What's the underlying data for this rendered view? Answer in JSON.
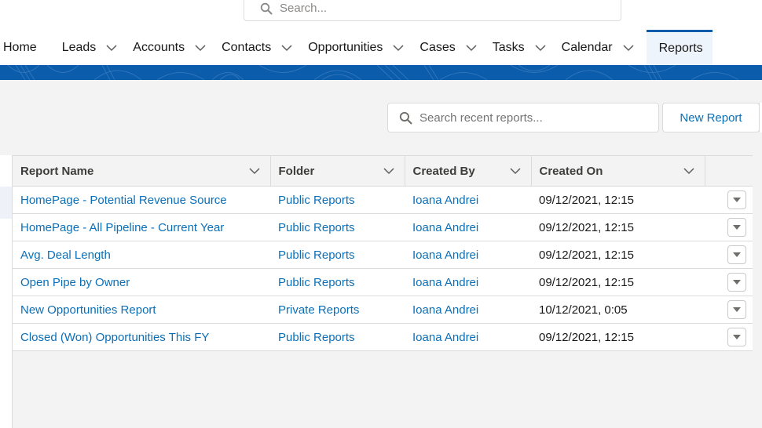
{
  "header": {
    "global_search_placeholder": "Search..."
  },
  "nav": {
    "items": [
      {
        "label": "Home",
        "has_menu": false
      },
      {
        "label": "Leads",
        "has_menu": true
      },
      {
        "label": "Accounts",
        "has_menu": true
      },
      {
        "label": "Contacts",
        "has_menu": true
      },
      {
        "label": "Opportunities",
        "has_menu": true
      },
      {
        "label": "Cases",
        "has_menu": true
      },
      {
        "label": "Tasks",
        "has_menu": true
      },
      {
        "label": "Calendar",
        "has_menu": true
      },
      {
        "label": "Reports",
        "has_menu": false,
        "active": true
      }
    ]
  },
  "toolbar": {
    "search_placeholder": "Search recent reports...",
    "new_report_label": "New Report"
  },
  "table": {
    "columns": [
      "Report Name",
      "Folder",
      "Created By",
      "Created On"
    ],
    "rows": [
      {
        "name": "HomePage - Potential Revenue Source",
        "folder": "Public Reports",
        "created_by": "Ioana Andrei",
        "created_on": "09/12/2021, 12:15"
      },
      {
        "name": "HomePage - All Pipeline - Current Year",
        "folder": "Public Reports",
        "created_by": "Ioana Andrei",
        "created_on": "09/12/2021, 12:15"
      },
      {
        "name": "Avg. Deal Length",
        "folder": "Public Reports",
        "created_by": "Ioana Andrei",
        "created_on": "09/12/2021, 12:15"
      },
      {
        "name": "Open Pipe by Owner",
        "folder": "Public Reports",
        "created_by": "Ioana Andrei",
        "created_on": "09/12/2021, 12:15"
      },
      {
        "name": "New Opportunities Report",
        "folder": "Private Reports",
        "created_by": "Ioana Andrei",
        "created_on": "10/12/2021, 0:05"
      },
      {
        "name": "Closed (Won) Opportunities This FY",
        "folder": "Public Reports",
        "created_by": "Ioana Andrei",
        "created_on": "09/12/2021, 12:15"
      }
    ]
  },
  "colors": {
    "brand_blue": "#0b5cab",
    "link_blue": "#0b6fb8",
    "background": "#f3f3f3"
  }
}
